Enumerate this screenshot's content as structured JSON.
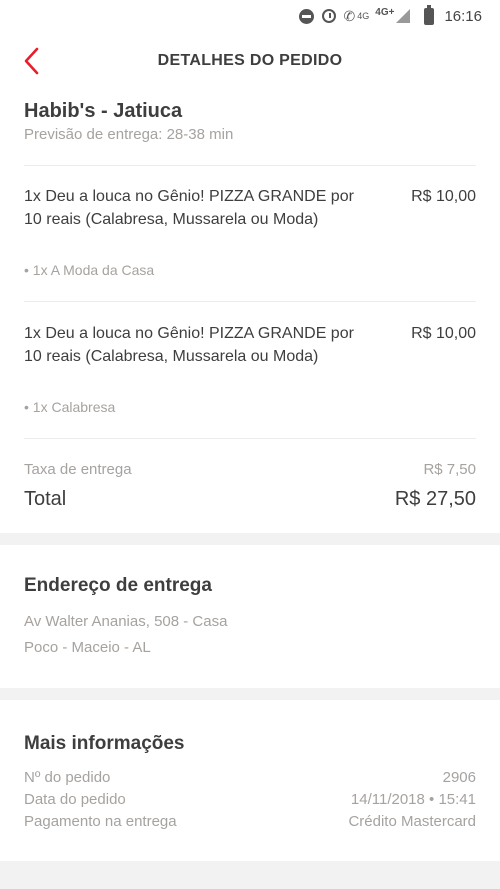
{
  "status_bar": {
    "network_small": "4G",
    "network": "4G+",
    "time": "16:16"
  },
  "header": {
    "title": "DETALHES DO PEDIDO",
    "accent_color": "#ea1d2c"
  },
  "restaurant": {
    "name": "Habib's - Jatiuca",
    "delivery_eta": "Previsão de entrega: 28-38 min"
  },
  "items": [
    {
      "name": "1x Deu a louca no Gênio! PIZZA GRANDE por 10 reais (Calabresa, Mussarela ou Moda)",
      "price": "R$ 10,00",
      "option": "• 1x A Moda da Casa"
    },
    {
      "name": "1x Deu a louca no Gênio! PIZZA GRANDE por 10 reais (Calabresa, Mussarela ou Moda)",
      "price": "R$ 10,00",
      "option": "• 1x Calabresa"
    }
  ],
  "totals": {
    "fee_label": "Taxa de entrega",
    "fee_value": "R$ 7,50",
    "total_label": "Total",
    "total_value": "R$ 27,50"
  },
  "address": {
    "title": "Endereço de entrega",
    "line1": "Av Walter Ananias, 508 - Casa",
    "line2": "Poco - Maceio - AL"
  },
  "more_info": {
    "title": "Mais informações",
    "order_number_label": "Nº do pedido",
    "order_number_value": "2906",
    "order_date_label": "Data do pedido",
    "order_date_value": "14/11/2018 • 15:41",
    "payment_label": "Pagamento na entrega",
    "payment_value": "Crédito Mastercard"
  }
}
